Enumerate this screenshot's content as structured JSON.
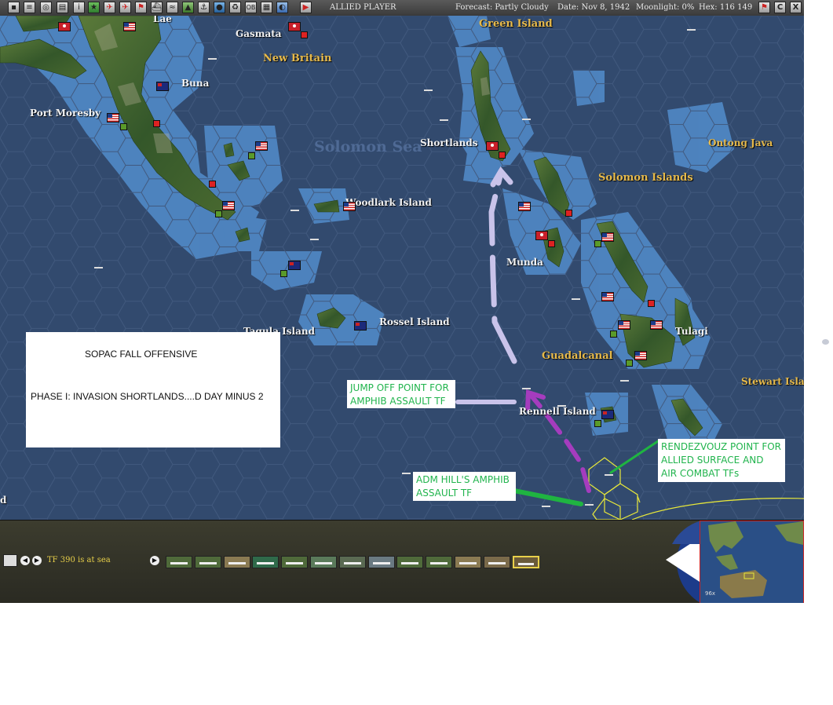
{
  "toolbar": {
    "player": "ALLIED PLAYER",
    "forecast": "Forecast: Partly Cloudy",
    "date": "Date: Nov 8, 1942",
    "moonlight": "Moonlight: 0%",
    "hex": "Hex: 116 149",
    "button_icons": [
      "map-icon",
      "list-icon",
      "target-icon",
      "report-icon",
      "intel-icon",
      "star-icon",
      "airplane-icon",
      "fighter-icon",
      "flag-icon",
      "ship-icon",
      "river-icon",
      "terrain-icon",
      "port-icon",
      "globe-icon",
      "recycle-icon",
      "ob-icon",
      "overlay-icon",
      "moon-icon",
      "play-icon"
    ],
    "ob_label": "OB",
    "right_buttons": [
      "flag-button",
      "c-button",
      "close-button"
    ],
    "c_label": "C",
    "close_label": "X"
  },
  "map": {
    "places": {
      "lae": "Lae",
      "gasmata": "Gasmata",
      "new_britain": "New Britain",
      "green_island": "Green Island",
      "buna": "Buna",
      "port_moresby": "Port Moresby",
      "solomon_sea": "Solomon Sea",
      "shortlands": "Shortlands",
      "ontong_java": "Ontong Java",
      "solomon_islands": "Solomon Islands",
      "woodlark_island": "Woodlark Island",
      "munda": "Munda",
      "tulagi": "Tulagi",
      "tagula_island": "Tagula Island",
      "rossel_island": "Rossel Island",
      "guadalcanal": "Guadalcanal",
      "stewart_islands": "Stewart Islan",
      "rennell_island": "Rennell Island",
      "edge_label": "d"
    }
  },
  "annotations": {
    "panel_title": "SOPAC FALL OFFENSIVE",
    "panel_subtitle": "PHASE I: INVASION SHORTLANDS....D DAY MINUS 2",
    "jump_off": [
      "JUMP OFF POINT FOR",
      "AMPHIB ASSAULT TF"
    ],
    "rendezvous": [
      "RENDEZVOUZ POINT FOR",
      "ALLIED SURFACE AND",
      "AIR COMBAT TFs"
    ],
    "adm_hill": [
      "ADM HILL'S AMPHIB",
      "ASSAULT TF"
    ]
  },
  "bottom_panel": {
    "status": "TF 390 is at sea",
    "ship_count": 13,
    "selected_ship_index": 12
  },
  "minimap": {
    "zoom_label": "96x"
  },
  "colors": {
    "ocean": "#324a6e",
    "shallows": "#4f86c2",
    "land": "#3f6a2a",
    "highlight_yellow": "#e8e83a",
    "arrow_lavender": "#c9c3ea",
    "arrow_purple": "#a53cbe",
    "arrow_green": "#1fb441",
    "annotation_green": "#21b44d"
  }
}
